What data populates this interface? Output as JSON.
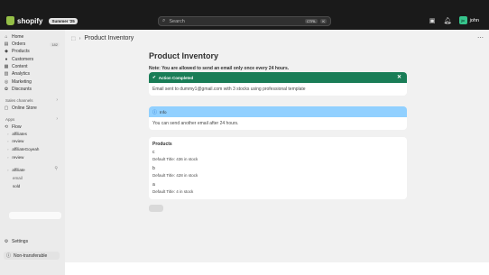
{
  "topbar": {
    "brand": "shopify",
    "edition": "Summer '25",
    "search_placeholder": "Search",
    "shortcut_ctrl": "CTRL",
    "shortcut_k": "K",
    "user_initials": "jo",
    "user_name": "john"
  },
  "sidebar": {
    "items": [
      {
        "label": "Home",
        "icon": "home-icon"
      },
      {
        "label": "Orders",
        "icon": "orders-icon",
        "count": "182"
      },
      {
        "label": "Products",
        "icon": "products-icon"
      },
      {
        "label": "Customers",
        "icon": "customers-icon"
      },
      {
        "label": "Content",
        "icon": "content-icon"
      },
      {
        "label": "Analytics",
        "icon": "analytics-icon"
      },
      {
        "label": "Marketing",
        "icon": "marketing-icon"
      },
      {
        "label": "Discounts",
        "icon": "discounts-icon"
      }
    ],
    "sales_channels_label": "Sales channels",
    "online_store": "Online Store",
    "apps_label": "Apps",
    "flow": "Flow",
    "apps": [
      "affiliates",
      "review",
      "affiliateGoyeah",
      "review",
      "affiliate"
    ],
    "children": [
      "email",
      "sold"
    ],
    "settings": "Settings",
    "plan": "Non-transferable"
  },
  "main": {
    "breadcrumb_title": "Product Inventory",
    "heading": "Product Inventory",
    "note": "Note: You are allowed to send an email only once every 24 hours.",
    "success": {
      "title": "Action Completed",
      "message": "Email sent to dummy1@gmail.com with 3 stocks using professional template"
    },
    "info": {
      "title": "Info",
      "message": "You can send another email after 24 hours."
    },
    "products": {
      "title": "Products",
      "items": [
        {
          "name": "c",
          "detail": "Default Title: 436 in stock"
        },
        {
          "name": "b",
          "detail": "Default Title: 428 in stock"
        },
        {
          "name": "a",
          "detail": "Default Title: 4 in stock"
        }
      ]
    }
  },
  "colors": {
    "topbar": "#1a1a1a",
    "success": "#1a7d57",
    "info": "#91d0ff",
    "brand_green": "#95bf47"
  }
}
